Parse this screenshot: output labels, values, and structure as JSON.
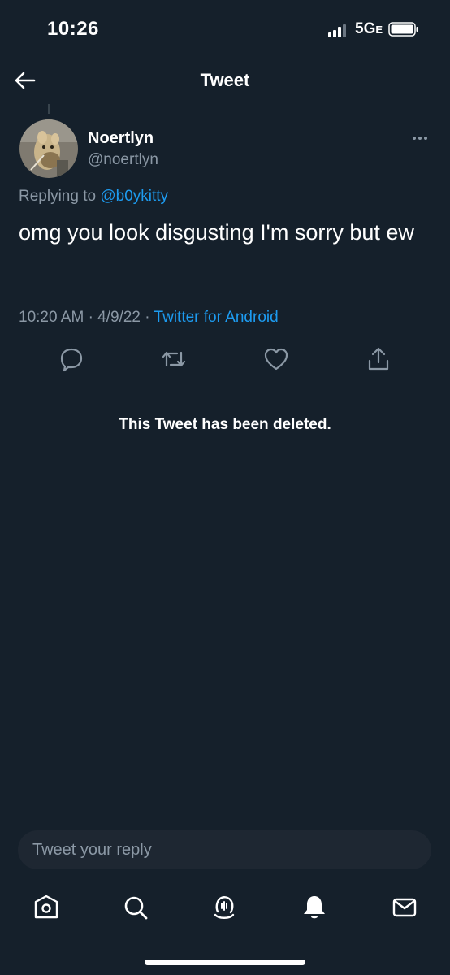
{
  "status_bar": {
    "time": "10:26",
    "network": "5G",
    "network_suffix": "E"
  },
  "header": {
    "title": "Tweet",
    "back_icon": "arrow-left-icon"
  },
  "tweet": {
    "author_name": "Noertlyn",
    "author_handle": "@noertlyn",
    "replying_prefix": "Replying to ",
    "replying_to": "@b0ykitty",
    "text": "omg you look disgusting I'm sorry but ew",
    "time": "10:20 AM",
    "date": "4/9/22",
    "separator": "·",
    "source": "Twitter for Android",
    "actions": [
      "reply-icon",
      "retweet-icon",
      "like-icon",
      "share-icon"
    ]
  },
  "deleted_notice": "This Tweet has been deleted.",
  "composer": {
    "placeholder": "Tweet your reply"
  },
  "tabs": [
    "home-icon",
    "search-icon",
    "spaces-icon",
    "notifications-icon",
    "messages-icon"
  ],
  "colors": {
    "background": "#15202b",
    "accent": "#1d9bf0",
    "secondary_text": "#8b98a5"
  }
}
